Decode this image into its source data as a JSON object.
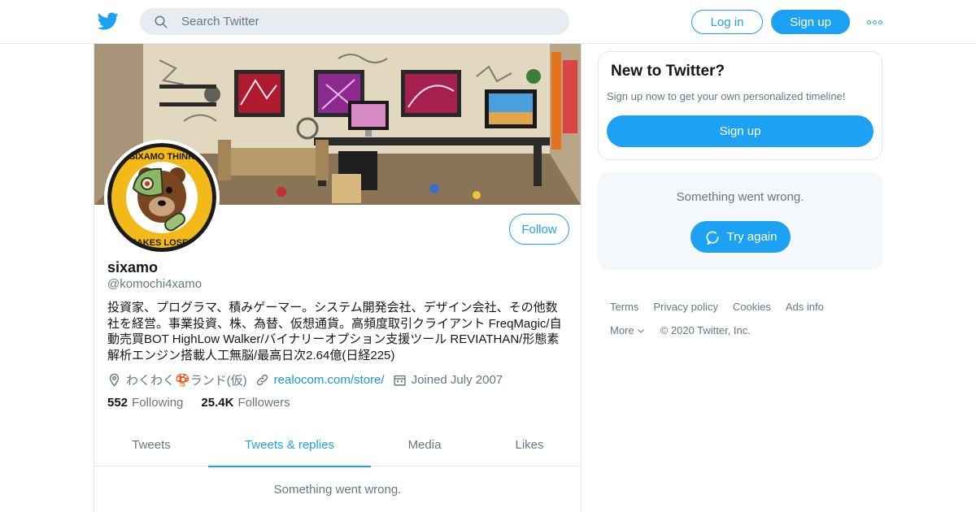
{
  "header": {
    "search_placeholder": "Search Twitter",
    "login_label": "Log in",
    "signup_label": "Sign up"
  },
  "profile": {
    "name": "sixamo",
    "handle": "@komochi4xamo",
    "bio": "投資家、プログラマ、積みゲーマー。システム開発会社、デザイン会社、その他数社を経営。事業投資、株、為替、仮想通貨。高頻度取引クライアント FreqMagic/自動売買BOT HighLow Walker/バイナリーオプション支援ツール REVIATHAN/形態素解析エンジン搭載人工無脳/最高日次2.64億(日経225)",
    "location": "わくわく🍄ランド(仮)",
    "website": "realocom.com/store/",
    "joined": "Joined July 2007",
    "following_count": "552",
    "following_label": "Following",
    "followers_count": "25.4K",
    "followers_label": "Followers",
    "follow_label": "Follow",
    "avatar_badge_top": "SIXAMO THINK",
    "avatar_badge_bottom": "MAKES LOSER"
  },
  "tabs": [
    {
      "label": "Tweets",
      "active": false
    },
    {
      "label": "Tweets & replies",
      "active": true
    },
    {
      "label": "Media",
      "active": false
    },
    {
      "label": "Likes",
      "active": false
    }
  ],
  "timeline": {
    "error_text": "Something went wrong."
  },
  "sidebar": {
    "new_title": "New to Twitter?",
    "new_subtitle": "Sign up now to get your own personalized timeline!",
    "signup_label": "Sign up",
    "error_text": "Something went wrong.",
    "retry_label": "Try again"
  },
  "footer": {
    "links": [
      "Terms",
      "Privacy policy",
      "Cookies",
      "Ads info"
    ],
    "more_label": "More",
    "copyright": "© 2020 Twitter, Inc."
  },
  "colors": {
    "accent": "#1da1f2",
    "muted": "#657786",
    "border": "#e1e8ed"
  }
}
